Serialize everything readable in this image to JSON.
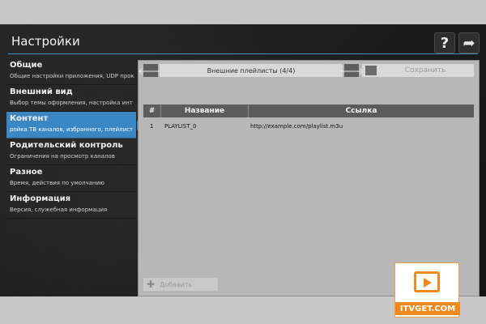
{
  "header": {
    "title": "Настройки",
    "help_icon": "?",
    "forward_icon": "➦"
  },
  "sidebar": {
    "items": [
      {
        "title": "Общие",
        "subtitle": "Общие настройки приложения, UDP прок"
      },
      {
        "title": "Внешний вид",
        "subtitle": "Выбор темы оформления, настройка инт"
      },
      {
        "title": "Контент",
        "subtitle": "ройка ТВ каналов, избранного, плейлист"
      },
      {
        "title": "Родительский контроль",
        "subtitle": "Ограничения на просмотр каналов"
      },
      {
        "title": "Разное",
        "subtitle": "Время, действия по умолчанию"
      },
      {
        "title": "Информация",
        "subtitle": "Версия, служебная информация"
      }
    ]
  },
  "panel": {
    "title": "Внешние плейлисты (4/4)",
    "save_label": "Сохранить",
    "add_label": "Добавить",
    "prev_icon": "🡐",
    "next_icon": "🡒",
    "columns": [
      "#",
      "Название",
      "Ссылка"
    ],
    "rows": [
      {
        "num": "1",
        "name": "PLAYLIST_0",
        "url": "http://example.com/playlist.m3u"
      }
    ]
  },
  "logo": {
    "text": "ITVGET.COM"
  },
  "colors": {
    "accent": "#3b87c4",
    "logo_orange": "#f08a1c"
  }
}
